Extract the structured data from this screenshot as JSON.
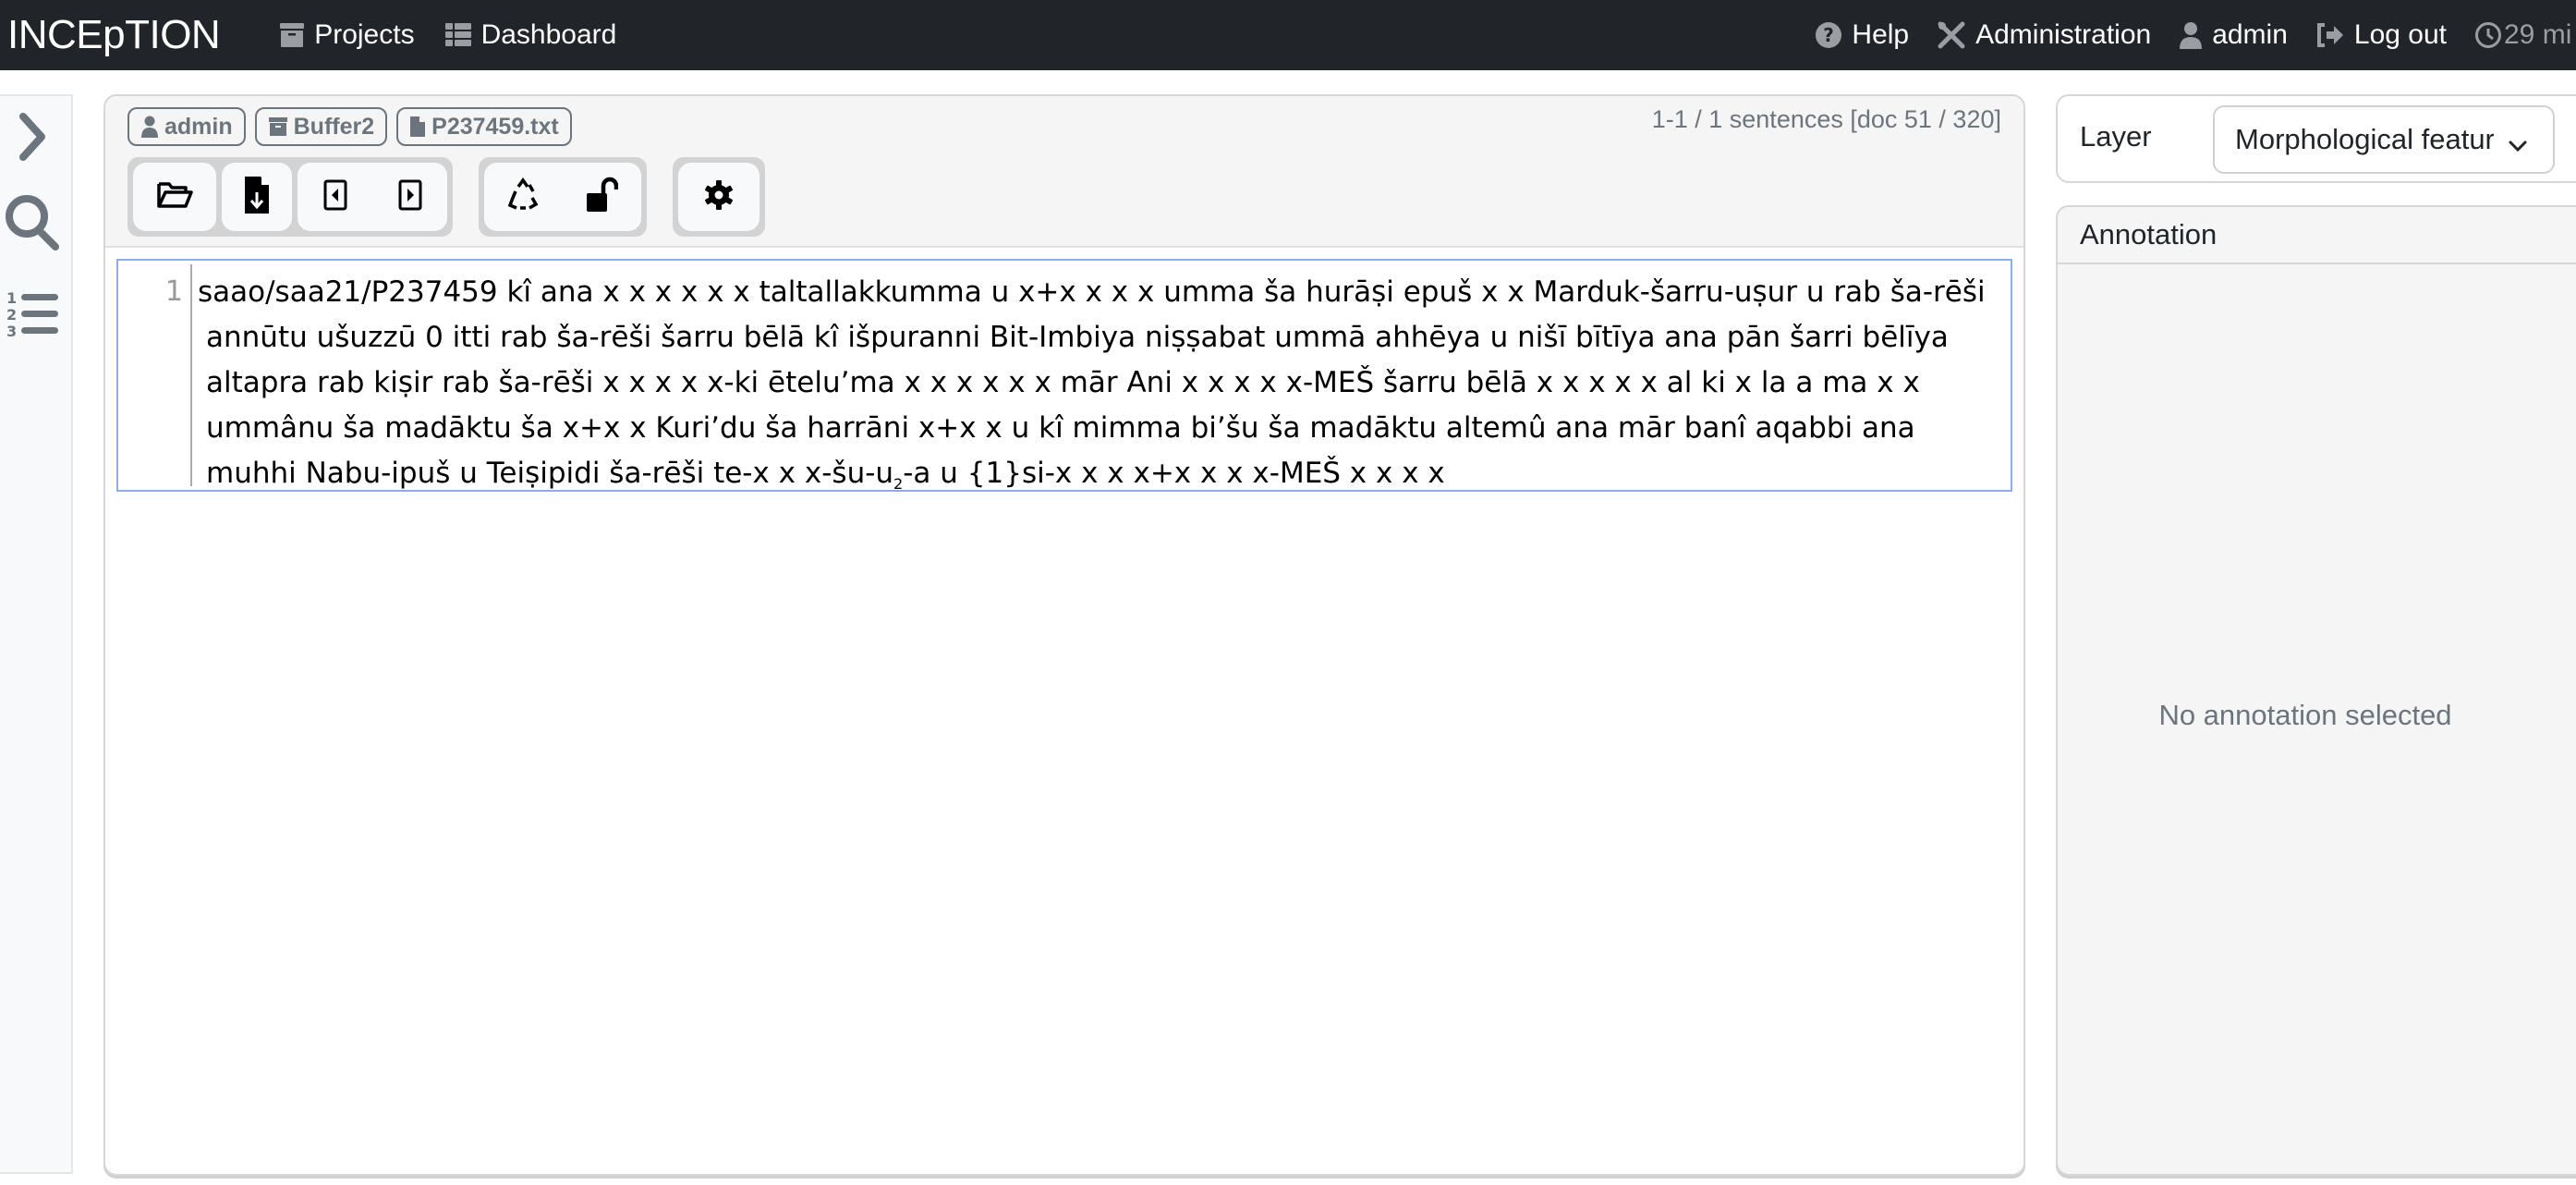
{
  "navbar": {
    "brand": "INCEpTION",
    "left_items": [
      {
        "label": "Projects",
        "icon": "archive-icon"
      },
      {
        "label": "Dashboard",
        "icon": "grid-list-icon"
      }
    ],
    "right_items": [
      {
        "label": "Help",
        "icon": "question-circle-icon"
      },
      {
        "label": "Administration",
        "icon": "tools-icon"
      },
      {
        "label": "admin",
        "icon": "user-icon"
      },
      {
        "label": "Log out",
        "icon": "sign-out-icon"
      }
    ],
    "timer": "29 mi"
  },
  "sidebar": {
    "items": [
      {
        "icon": "chevron-right-icon",
        "label": "Expand"
      },
      {
        "icon": "search-icon",
        "label": "Search"
      },
      {
        "icon": "ordered-list-icon",
        "label": "Outline"
      }
    ]
  },
  "editor": {
    "badges": [
      {
        "label": "admin",
        "icon": "user-icon"
      },
      {
        "label": "Buffer2",
        "icon": "archive-icon"
      },
      {
        "label": "P237459.txt",
        "icon": "file-icon"
      }
    ],
    "sentence_info": "1-1 / 1 sentences [doc 51 / 320]",
    "toolbar": {
      "open_document": "Open document",
      "export_document": "Export document",
      "previous_document": "Previous document",
      "next_document": "Next document",
      "reset_document": "Reset document",
      "finish_document": "Finish document",
      "settings": "Settings"
    },
    "line_number": "1",
    "text_lines": [
      "saao/saa21/P237459 kî ana x x x x x x taltallakkumma u x+x x x x umma ša hurāṣi epuš x x Marduk-šarru-uṣur u rab ša-rēši",
      "annūtu ušuzzū 0 itti rab ša-rēši šarru bēlā kî išpuranni Bit-Imbiya niṣṣabat ummā ahhēya u nišī bītīya ana pān šarri bēlīya",
      "altapra rab kiṣir rab ša-rēši x x x x x-ki ētelu’ma x x x x x x mār Ani x x x x x-MEŠ šarru bēlā x x x x x al ki x la a ma x x",
      "ummânu ša madāktu ša x+x x Kuri’du ša harrāni x+x x u kî mimma bi’šu ša madāktu altemû ana mār banî aqabbi ana"
    ],
    "last_line": {
      "before_sub": "muhhi Nabu-ipuš u Teiṣipidi ša-rēši te-x x x-šu-u",
      "sub": "2",
      "after_sub": "-a u {1}si-x x x x+x x x x-MEŠ x x x x"
    }
  },
  "right_panel": {
    "layer_label": "Layer",
    "layer_value": "Morphological features",
    "annotation_header": "Annotation",
    "empty_message": "No annotation selected"
  }
}
